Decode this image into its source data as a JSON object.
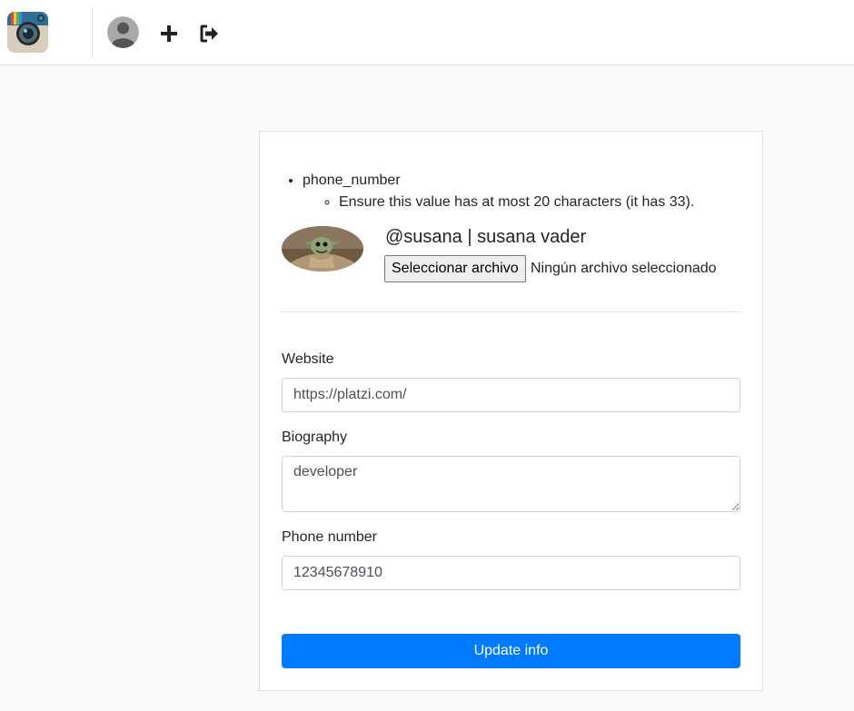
{
  "navbar": {
    "logo_icon": "camera-logo-icon",
    "avatar_icon": "user-avatar-icon",
    "add_icon": "plus-icon",
    "logout_icon": "sign-out-icon"
  },
  "errors": {
    "field": "phone_number",
    "messages": [
      "Ensure this value has at most 20 characters (it has 33)."
    ]
  },
  "profile": {
    "display": "@susana | susana vader",
    "file_button_label": "Seleccionar archivo",
    "file_status": "Ningún archivo seleccionado"
  },
  "form": {
    "website": {
      "label": "Website",
      "value": "https://platzi.com/"
    },
    "biography": {
      "label": "Biography",
      "value": "developer"
    },
    "phone_number": {
      "label": "Phone number",
      "value": "12345678910"
    },
    "submit_label": "Update info"
  },
  "colors": {
    "primary": "#007bff",
    "background": "#fafafa",
    "border": "#ced4da"
  }
}
